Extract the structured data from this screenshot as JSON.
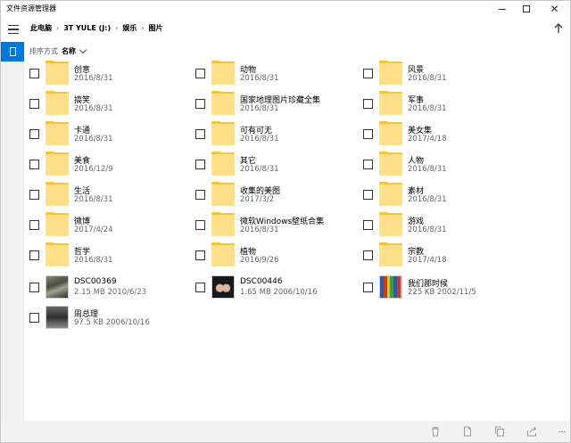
{
  "window": {
    "title": "文件资源管理器",
    "controls": {
      "close": "✕"
    }
  },
  "nav": {
    "breadcrumb": [
      "此电脑",
      "3T YULE (J:)",
      "娱乐",
      "图片"
    ],
    "separator": "›"
  },
  "sort": {
    "label": "排序方式",
    "value": "名称"
  },
  "items": [
    {
      "name": "创意",
      "meta": "2016/8/31",
      "kind": "folder"
    },
    {
      "name": "动物",
      "meta": "2016/8/31",
      "kind": "folder"
    },
    {
      "name": "风景",
      "meta": "2016/8/31",
      "kind": "folder"
    },
    {
      "name": "搞笑",
      "meta": "2016/8/31",
      "kind": "folder"
    },
    {
      "name": "国家地理图片珍藏全集",
      "meta": "2016/8/31",
      "kind": "folder"
    },
    {
      "name": "军事",
      "meta": "2016/8/31",
      "kind": "folder"
    },
    {
      "name": "卡通",
      "meta": "2016/8/31",
      "kind": "folder"
    },
    {
      "name": "可有可无",
      "meta": "2016/8/31",
      "kind": "folder"
    },
    {
      "name": "美女集",
      "meta": "2017/4/18",
      "kind": "folder"
    },
    {
      "name": "美食",
      "meta": "2016/12/9",
      "kind": "folder"
    },
    {
      "name": "其它",
      "meta": "2016/8/31",
      "kind": "folder"
    },
    {
      "name": "人物",
      "meta": "2016/8/31",
      "kind": "folder"
    },
    {
      "name": "生活",
      "meta": "2016/8/31",
      "kind": "folder"
    },
    {
      "name": "收集的美图",
      "meta": "2017/3/2",
      "kind": "folder"
    },
    {
      "name": "素材",
      "meta": "2016/8/31",
      "kind": "folder"
    },
    {
      "name": "微博",
      "meta": "2017/4/24",
      "kind": "folder"
    },
    {
      "name": "微软Windows壁纸合集",
      "meta": "2016/8/31",
      "kind": "folder"
    },
    {
      "name": "游戏",
      "meta": "2016/8/31",
      "kind": "folder"
    },
    {
      "name": "哲学",
      "meta": "2016/8/31",
      "kind": "folder"
    },
    {
      "name": "植物",
      "meta": "2016/9/26",
      "kind": "folder"
    },
    {
      "name": "宗教",
      "meta": "2017/4/18",
      "kind": "folder"
    },
    {
      "name": "DSC00369",
      "meta": "2.15 MB 2010/6/23",
      "kind": "photo"
    },
    {
      "name": "DSC00446",
      "meta": "1.65 MB 2006/10/16",
      "kind": "photo"
    },
    {
      "name": "我们那时候",
      "meta": "225 KB 2002/11/5",
      "kind": "photo"
    },
    {
      "name": "周总理",
      "meta": "97.5 KB 2006/10/16",
      "kind": "photo"
    }
  ],
  "bottombar": {
    "more": "..."
  },
  "colors": {
    "accent": "#0078d7",
    "folder": "#ffd766",
    "rail": "#f0f0f0",
    "bottombar": "#f2f2f2"
  }
}
